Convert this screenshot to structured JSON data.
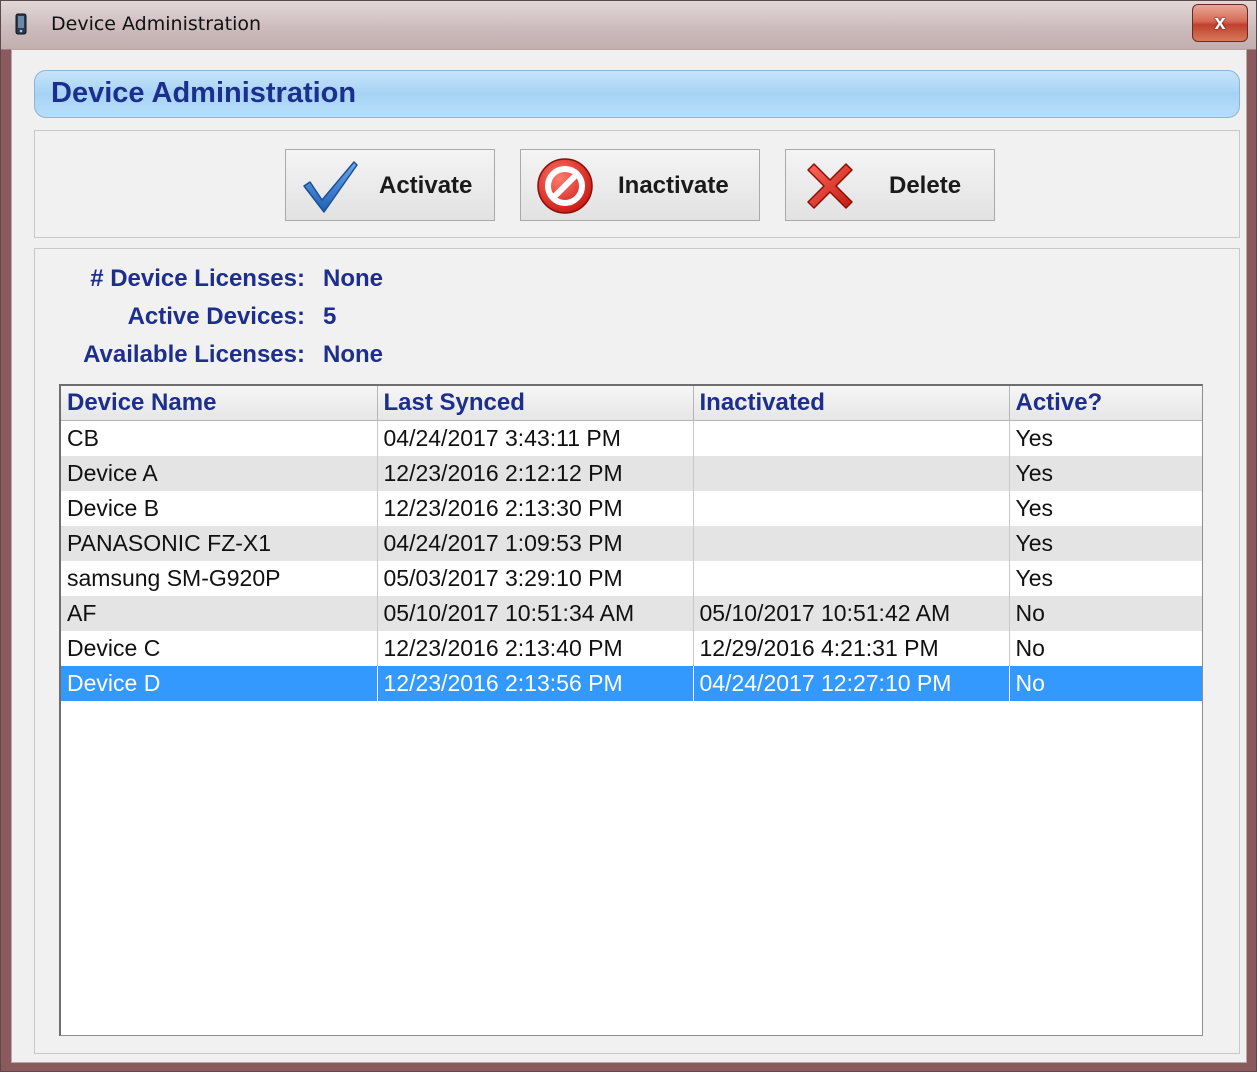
{
  "window": {
    "title": "Device Administration",
    "close_label": "x"
  },
  "header": {
    "title": "Device Administration"
  },
  "toolbar": {
    "activate_label": "Activate",
    "inactivate_label": "Inactivate",
    "delete_label": "Delete"
  },
  "icons": {
    "title": "device-icon",
    "activate": "checkmark-icon",
    "inactivate": "prohibited-icon",
    "delete": "red-x-icon"
  },
  "colors": {
    "header_text": "#1d2f8c",
    "selection": "#3399ff",
    "header_bar": "#a6d3f4"
  },
  "summary": {
    "device_licenses_label": "# Device Licenses:",
    "device_licenses_value": "None",
    "active_devices_label": "Active Devices:",
    "active_devices_value": "5",
    "available_licenses_label": "Available Licenses:",
    "available_licenses_value": "None"
  },
  "grid": {
    "columns": [
      "Device Name",
      "Last Synced",
      "Inactivated",
      "Active?"
    ],
    "rows": [
      {
        "name": "CB",
        "last_synced": "04/24/2017 3:43:11 PM",
        "inactivated": "",
        "active": "Yes"
      },
      {
        "name": "Device A",
        "last_synced": "12/23/2016 2:12:12 PM",
        "inactivated": "",
        "active": "Yes"
      },
      {
        "name": "Device B",
        "last_synced": "12/23/2016 2:13:30 PM",
        "inactivated": "",
        "active": "Yes"
      },
      {
        "name": "PANASONIC FZ-X1",
        "last_synced": "04/24/2017 1:09:53 PM",
        "inactivated": "",
        "active": "Yes"
      },
      {
        "name": "samsung SM-G920P",
        "last_synced": "05/03/2017 3:29:10 PM",
        "inactivated": "",
        "active": "Yes"
      },
      {
        "name": "AF",
        "last_synced": "05/10/2017 10:51:34 AM",
        "inactivated": "05/10/2017 10:51:42 AM",
        "active": "No"
      },
      {
        "name": "Device C",
        "last_synced": "12/23/2016 2:13:40 PM",
        "inactivated": "12/29/2016 4:21:31 PM",
        "active": "No"
      },
      {
        "name": "Device D",
        "last_synced": "12/23/2016 2:13:56 PM",
        "inactivated": "04/24/2017 12:27:10 PM",
        "active": "No"
      }
    ],
    "selected_index": 7
  }
}
